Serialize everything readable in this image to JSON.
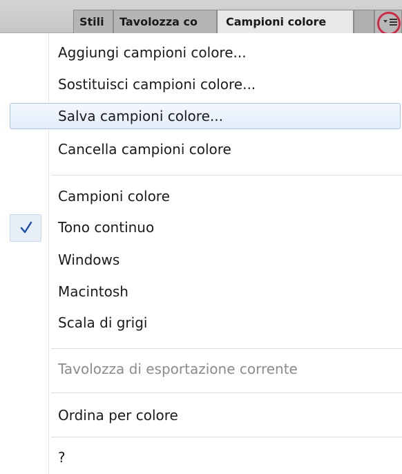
{
  "panel": {
    "tabs": [
      "Stili",
      "Tavolozza co",
      "Campioni colore"
    ],
    "menu_icon": "panel-menu-icon",
    "highlight_color": "#cc2a45"
  },
  "menu": {
    "items": [
      "Aggiungi campioni colore...",
      "Sostituisci campioni colore...",
      "Salva campioni colore...",
      "Cancella campioni colore",
      "Campioni colore",
      "Tono continuo",
      "Windows",
      "Macintosh",
      "Scala di grigi",
      "Tavolozza di esportazione corrente",
      "Ordina per colore",
      "?"
    ],
    "hovered_item": "Salva campioni colore...",
    "checked_item": "Tono continuo",
    "disabled_item": "Tavolozza di esportazione corrente",
    "check_color": "#1f4fa8"
  }
}
